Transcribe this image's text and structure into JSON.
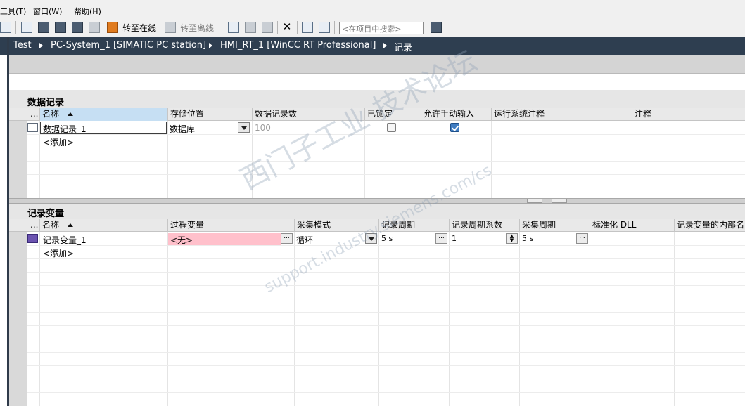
{
  "menu": {
    "tools": "工具(T)",
    "window": "窗口(W)",
    "help": "帮助(H)"
  },
  "toolbar": {
    "go_online": "转至在线",
    "go_offline": "转至离线",
    "search_placeholder": "<在项目中搜索>"
  },
  "breadcrumb": [
    "Test",
    "PC-System_1 [SIMATIC PC station]",
    "HMI_RT_1 [WinCC RT Professional]",
    "记录"
  ],
  "data_logs": {
    "title": "数据记录",
    "columns": [
      "...",
      "名称",
      "存储位置",
      "数据记录数",
      "已锁定",
      "允许手动输入",
      "运行系统注释",
      "注释"
    ],
    "rows": [
      {
        "name": "数据记录_1",
        "storage": "数据库",
        "count": "100",
        "locked": false,
        "manual_input": true
      }
    ],
    "add_label": "<添加>"
  },
  "log_tags": {
    "title": "记录变量",
    "columns": [
      "...",
      "名称",
      "过程变量",
      "采集模式",
      "记录周期",
      "记录周期系数",
      "采集周期",
      "标准化 DLL",
      "记录变量的内部名"
    ],
    "rows": [
      {
        "name": "记录变量_1",
        "process_tag": "<无>",
        "acq_mode": "循环",
        "log_cycle": "5 s",
        "cycle_factor": "1",
        "acq_cycle": "5 s"
      }
    ],
    "add_label": "<添加>"
  },
  "watermark": {
    "line1": "西门子工业 技术论坛",
    "line2": "support.industry.siemens.com/cs"
  },
  "colors": {
    "breadcrumb_bg": "#2e3e50",
    "sort_header": "#c6dff3",
    "error_cell": "#ffc0cb",
    "checkbox_checked": "#3f7cc1"
  }
}
